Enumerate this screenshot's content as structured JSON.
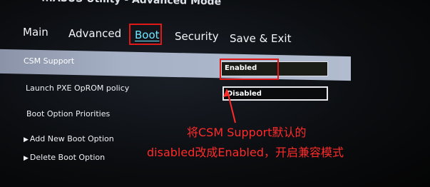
{
  "header": {
    "title": "...ASUS Utility - Advanced Mode"
  },
  "tabs": [
    {
      "label": "Main",
      "active": false
    },
    {
      "label": "Advanced",
      "active": false
    },
    {
      "label": "Boot",
      "active": true
    },
    {
      "label": "Security",
      "active": false
    },
    {
      "label": "Save & Exit",
      "active": false
    }
  ],
  "settings": {
    "csm_support": {
      "label": "CSM Support",
      "value": "Enabled"
    },
    "pxe_policy": {
      "label": "Launch PXE OpROM policy",
      "value": "Disabled"
    },
    "boot_priorities_label": "Boot Option Priorities",
    "add_boot_option": "Add New Boot Option",
    "delete_boot_option": "Delete Boot Option"
  },
  "annotation": {
    "line1": "将CSM Support默认的",
    "line2": "disabled改成Enabled，开启兼容模式"
  },
  "colors": {
    "annotation": "#ff2b2b",
    "highlight_row": "#a7b1c6",
    "active_tab": "#6ee7ff"
  }
}
